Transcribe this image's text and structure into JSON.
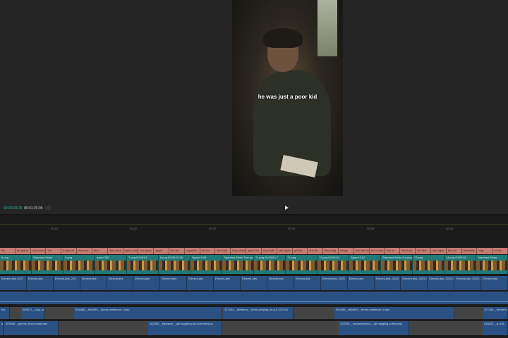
{
  "preview": {
    "caption": "he was just a poor kid",
    "current_time": "00:00:09:20",
    "total_time": "00:01:26:05"
  },
  "ruler": {
    "ticks": [
      "00:15",
      "00:20",
      "00:25",
      "00:30",
      "00:35",
      "00:40"
    ]
  },
  "text_track": [
    "No",
    "for grand",
    "step-wasting at",
    "the",
    "it was all",
    "them ca",
    "face",
    "they were",
    "tight crowd",
    "she grew",
    "again",
    "the ret",
    "organize",
    "the thr",
    "the truth",
    "they stolen",
    "again the",
    "they both",
    "she again",
    "gif him",
    "she sh",
    "they long",
    "things",
    "and the love",
    "and move",
    "she sh",
    "the truth",
    "her first",
    "she ages",
    "the old",
    "thermally",
    "bag",
    "not at"
  ],
  "video_track": [
    "5.png",
    "Standard Mode",
    "6.png",
    "asset 300",
    "7.png 00:00:01",
    "8.png 00:00:02:26",
    "Speed 0.96",
    "Standard Mode Two young men",
    "11.png 00:00:04:7",
    "12.png",
    "13.png 00:00:01",
    "Speed 0.92",
    "Standard Mode A young woman initially smiles",
    "13.png",
    "14.png 00:00:01",
    "Standard Mode"
  ],
  "audio1": [
    "ElevenLabs_202",
    "ElevenLabs",
    "ElevenLabs_202",
    "ElevenLabs",
    "ElevenLabs",
    "ElevenLabs",
    "ElevenLabs",
    "ElevenLabs",
    "ElevenLabs",
    "ElevenLabs",
    "ElevenLabs",
    "ElevenLabs",
    "ElevenLabs_2025",
    "ElevenLabs",
    "ElevenLabs_2025-",
    "ElevenLabs_2025-04-09T07_02_18",
    "ElevenLabs_2025-04-",
    "ElevenLabs_2025-04-09T07_0",
    "ElevenLabs"
  ],
  "audio3": [
    "tes",
    "469872__14g_ss",
    "504466__felix993__forest-ambience-1.wav",
    "327444__theslitroz__birds-chirping-on-a-tr 327444",
    "504466__felix993__forest-ambience-1.wav",
    "327444__theslitroz"
  ],
  "audio4": [
    "aa",
    "405058__aurens_floor-creak.wav",
    "382390__bbarazm__girl-laughing-and-chuckling.w",
    "219700__madamvicious__girl-giggling-cutely.wav",
    "538223__jz 536"
  ]
}
